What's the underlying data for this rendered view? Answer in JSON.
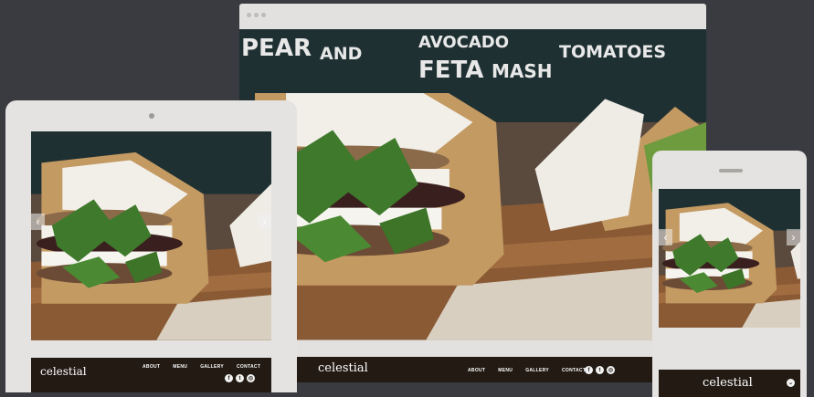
{
  "chalkboard": {
    "line1a": "PEAR",
    "line1b": "AND",
    "line2a": "FETA",
    "line2b": "MASH",
    "top": "AVOCADO",
    "right": "TOMATOES"
  },
  "site": {
    "brand": "celestial",
    "nav": [
      "ABOUT",
      "MENU",
      "GALLERY",
      "CONTACT"
    ],
    "social": [
      {
        "icon": "facebook-icon",
        "glyph": "f"
      },
      {
        "icon": "twitter-icon",
        "glyph": "t"
      },
      {
        "icon": "instagram-icon",
        "glyph": "◎"
      }
    ],
    "arrows": {
      "prev": "‹",
      "next": "›"
    },
    "menu_toggle": "⌄"
  },
  "colors": {
    "background": "#3a3b40",
    "device_frame": "#e4e3e1",
    "footer": "#221a13",
    "wood": "#8a5a34",
    "paper": "#c49a63"
  }
}
